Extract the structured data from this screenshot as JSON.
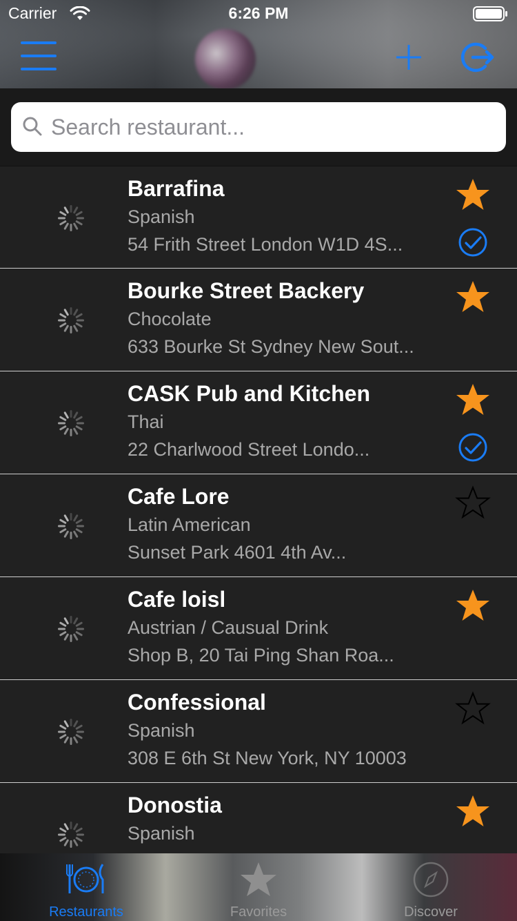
{
  "status_bar": {
    "carrier": "Carrier",
    "time": "6:26 PM"
  },
  "nav": {
    "menu_icon": "hamburger-menu-icon",
    "add_icon": "plus-icon",
    "logout_icon": "logout-icon",
    "accent_color": "#1a7cf5"
  },
  "search": {
    "placeholder": "Search restaurant...",
    "value": ""
  },
  "restaurants": [
    {
      "name": "Barrafina",
      "cuisine": "Spanish",
      "address": "54 Frith Street London W1D 4S...",
      "favorite": true,
      "visited": true
    },
    {
      "name": "Bourke Street Backery",
      "cuisine": "Chocolate",
      "address": "633 Bourke St Sydney New Sout...",
      "favorite": true,
      "visited": false
    },
    {
      "name": "CASK Pub and Kitchen",
      "cuisine": "Thai",
      "address": "22 Charlwood Street Londo...",
      "favorite": true,
      "visited": true
    },
    {
      "name": "Cafe Lore",
      "cuisine": "Latin American",
      "address": "Sunset Park 4601 4th Av...",
      "favorite": false,
      "visited": false
    },
    {
      "name": "Cafe loisl",
      "cuisine": "Austrian / Causual Drink",
      "address": "Shop B, 20 Tai Ping Shan Roa...",
      "favorite": true,
      "visited": false
    },
    {
      "name": "Confessional",
      "cuisine": "Spanish",
      "address": "308 E 6th St New York, NY 10003",
      "favorite": false,
      "visited": false
    },
    {
      "name": "Donostia",
      "cuisine": "Spanish",
      "address": "",
      "favorite": true,
      "visited": false
    }
  ],
  "tabs": [
    {
      "label": "Restaurants",
      "icon": "restaurant-plate-icon",
      "active": true
    },
    {
      "label": "Favorites",
      "icon": "star-icon",
      "active": false
    },
    {
      "label": "Discover",
      "icon": "compass-icon",
      "active": false
    }
  ],
  "colors": {
    "favorite_star": "#f7941d",
    "active_tab": "#1a7cf5",
    "inactive_tab": "#9a9a9a"
  }
}
